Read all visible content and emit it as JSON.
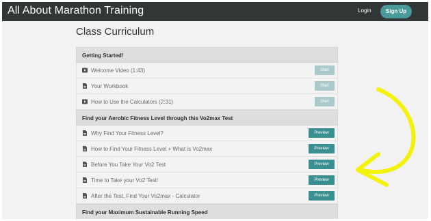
{
  "header": {
    "brand": "All About Marathon Training",
    "login_label": "Login",
    "signup_label": "Sign Up"
  },
  "page_title": "Class Curriculum",
  "sections": [
    {
      "title": "Getting Started!",
      "lectures": [
        {
          "icon": "video-icon",
          "label": "Welcome Video (1:43)",
          "button": "Start"
        },
        {
          "icon": "document-icon",
          "label": "Your Workbook",
          "button": "Start"
        },
        {
          "icon": "video-icon",
          "label": "How to Use the Calculators (2:31)",
          "button": "Start"
        }
      ]
    },
    {
      "title": "Find your Aerobic Fitness Level through this Vo2max Test",
      "lectures": [
        {
          "icon": "document-icon",
          "label": "Why Find Your Fitness Level?",
          "button": "Preview"
        },
        {
          "icon": "document-icon",
          "label": "How to Find Your Fitness Level + What is Vo2max",
          "button": "Preview"
        },
        {
          "icon": "document-icon",
          "label": "Before You Take Your Vo2 Test",
          "button": "Preview"
        },
        {
          "icon": "document-icon",
          "label": "Time to Take your Vo2 Test!",
          "button": "Preview"
        },
        {
          "icon": "document-icon",
          "label": "After the Test, Find Your Vo2max - Calculator",
          "button": "Preview"
        }
      ]
    },
    {
      "title": "Find your Maximum Sustainable Running Speed",
      "lectures": []
    }
  ],
  "colors": {
    "topbar": "#313637",
    "accent": "#4a9a9c",
    "start_button": "#a9c9ca",
    "preview_button": "#3a8f90",
    "annotation_arrow": "#f2f20a"
  }
}
